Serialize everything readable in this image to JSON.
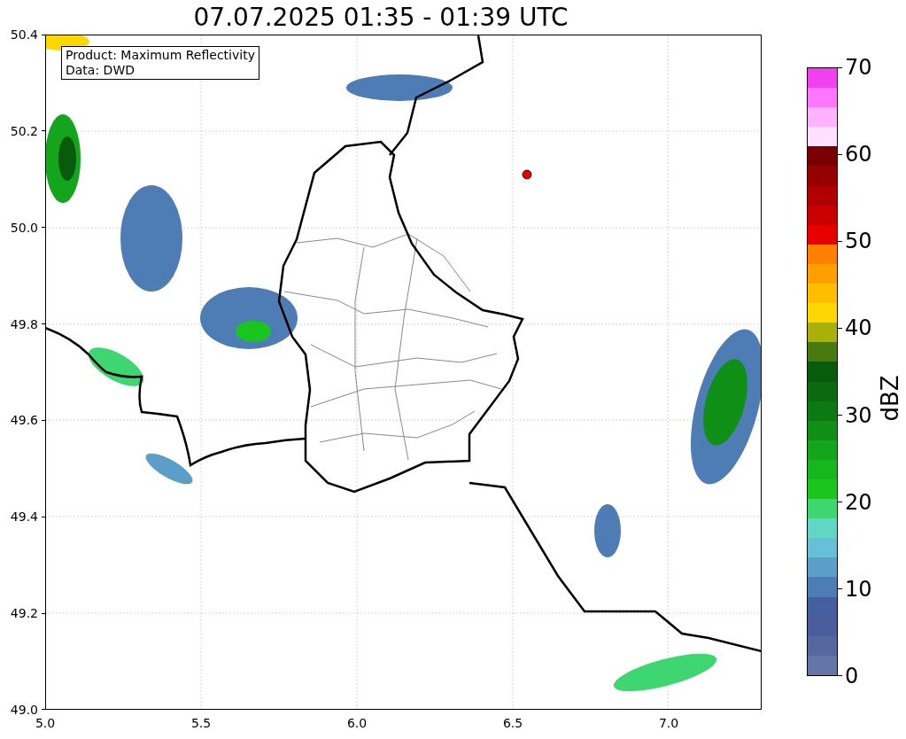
{
  "title": "07.07.2025 01:35 - 01:39 UTC",
  "info_box": {
    "lines": [
      "Product: Maximum Reflectivity",
      "Data: DWD"
    ]
  },
  "map": {
    "x_ticks": [
      "5.0",
      "5.5",
      "6.0",
      "6.5",
      "7.0"
    ],
    "y_ticks": [
      "50.4",
      "50.2",
      "50.0",
      "49.8",
      "49.6",
      "49.4",
      "49.2",
      "49.0"
    ]
  },
  "colorbar": {
    "label": "dBZ",
    "ticks": [
      "70",
      "60",
      "50",
      "40",
      "30",
      "20",
      "10",
      "0"
    ],
    "segments": [
      {
        "color": "#f040f0"
      },
      {
        "color": "#ff77ff"
      },
      {
        "color": "#ffb3ff"
      },
      {
        "color": "#ffe0ff"
      },
      {
        "color": "#780000"
      },
      {
        "color": "#960000"
      },
      {
        "color": "#b00000"
      },
      {
        "color": "#c80000"
      },
      {
        "color": "#e60000"
      },
      {
        "color": "#ff8000"
      },
      {
        "color": "#ffa000"
      },
      {
        "color": "#ffbf00"
      },
      {
        "color": "#ffd700"
      },
      {
        "color": "#aab00a"
      },
      {
        "color": "#4a7a0f"
      },
      {
        "color": "#085a0c"
      },
      {
        "color": "#0b6a10"
      },
      {
        "color": "#0c7a12"
      },
      {
        "color": "#108f16"
      },
      {
        "color": "#13a51b"
      },
      {
        "color": "#14b81c"
      },
      {
        "color": "#1ac61d"
      },
      {
        "color": "#3ed670"
      },
      {
        "color": "#62d6c4"
      },
      {
        "color": "#65c0d8"
      },
      {
        "color": "#5b9fc8"
      },
      {
        "color": "#4e7db5"
      },
      {
        "color": "#4460a0"
      },
      {
        "color": "#4a5e9e"
      },
      {
        "color": "#56679f"
      },
      {
        "color": "#6476a8"
      }
    ]
  }
}
